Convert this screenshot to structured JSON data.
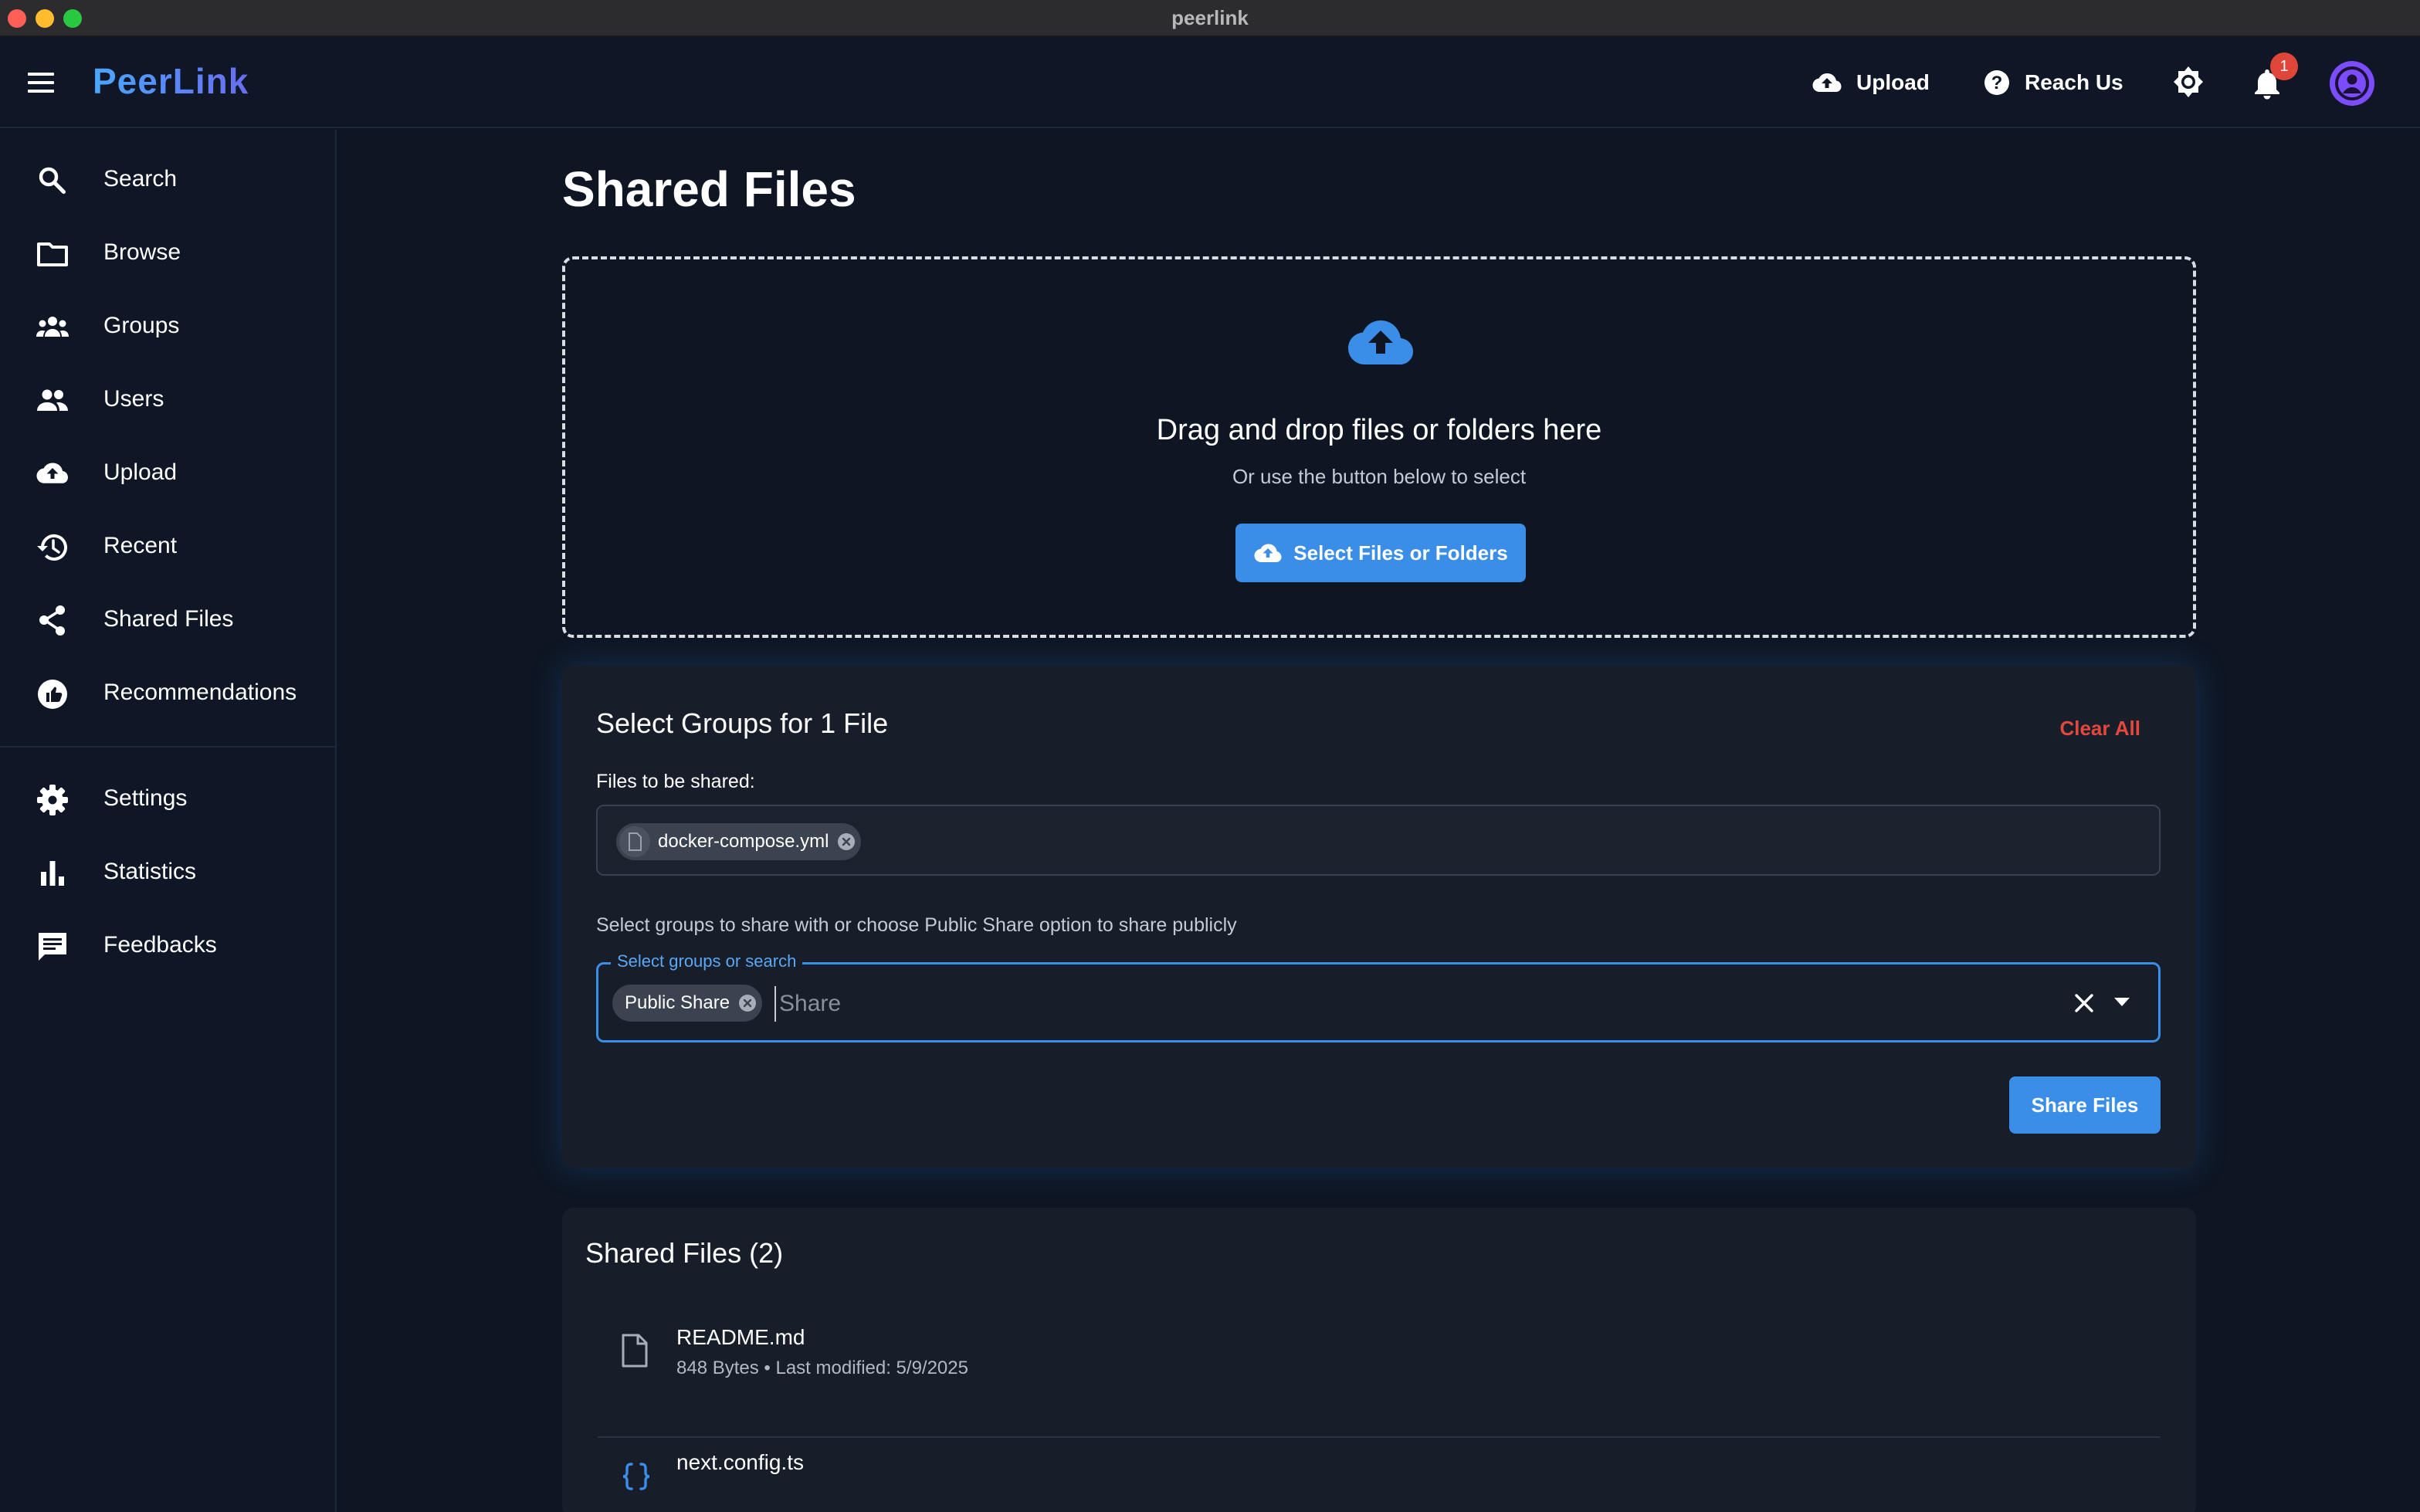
{
  "window": {
    "title": "peerlink"
  },
  "header": {
    "brand": "PeerLink",
    "upload_label": "Upload",
    "reach_label": "Reach Us",
    "notification_count": "1"
  },
  "sidebar": {
    "items": [
      {
        "label": "Search",
        "icon": "search-icon"
      },
      {
        "label": "Browse",
        "icon": "folder-icon"
      },
      {
        "label": "Groups",
        "icon": "groups-icon"
      },
      {
        "label": "Users",
        "icon": "users-icon"
      },
      {
        "label": "Upload",
        "icon": "cloud-upload-icon"
      },
      {
        "label": "Recent",
        "icon": "history-icon"
      },
      {
        "label": "Shared Files",
        "icon": "share-icon"
      },
      {
        "label": "Recommendations",
        "icon": "recommend-icon"
      },
      {
        "label": "Settings",
        "icon": "gear-icon"
      },
      {
        "label": "Statistics",
        "icon": "bar-chart-icon"
      },
      {
        "label": "Feedbacks",
        "icon": "feedback-icon"
      }
    ]
  },
  "main": {
    "title": "Shared Files",
    "dropzone": {
      "title": "Drag and drop files or folders here",
      "subtitle": "Or use the button below to select",
      "button_label": "Select Files or Folders"
    },
    "share_panel": {
      "title": "Select Groups for 1 File",
      "clear_all": "Clear All",
      "files_label": "Files to be shared:",
      "files": [
        "docker-compose.yml"
      ],
      "groups_hint": "Select groups to share with or choose Public Share option to share publicly",
      "groups_field_label": "Select groups or search",
      "selected_groups": [
        "Public Share"
      ],
      "groups_input_placeholder": "Share",
      "share_button": "Share Files"
    },
    "shared_list": {
      "title": "Shared Files (2)",
      "files": [
        {
          "name": "README.md",
          "meta": "848 Bytes • Last modified: 5/9/2025",
          "icon": "file-icon"
        },
        {
          "name": "next.config.ts",
          "meta": "",
          "icon": "code-braces-icon"
        }
      ]
    }
  },
  "colors": {
    "background": "#0e1623",
    "panel": "#171e2a",
    "accent": "#3b8ee8",
    "danger": "#e2483d",
    "avatar": "#7c4dff"
  }
}
